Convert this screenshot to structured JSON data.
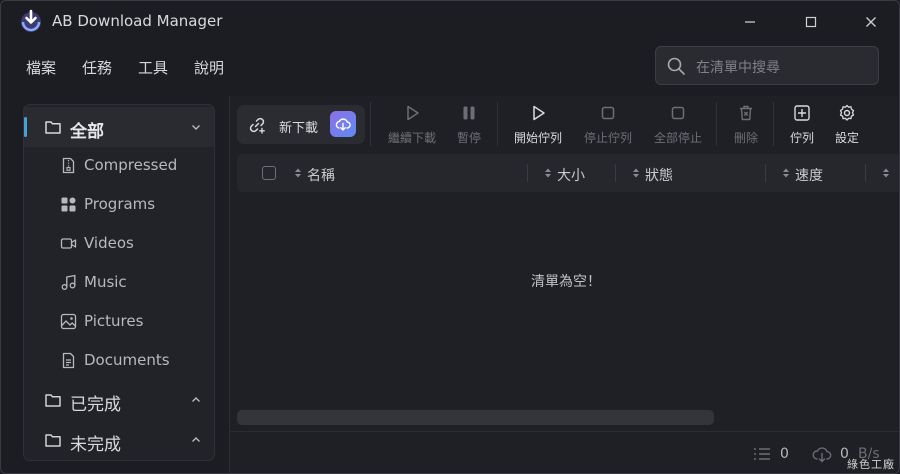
{
  "window": {
    "title": "AB Download Manager"
  },
  "menu": [
    "檔案",
    "任務",
    "工具",
    "說明"
  ],
  "search": {
    "placeholder": "在清單中搜尋"
  },
  "sidebar": {
    "all": "全部",
    "subs": [
      {
        "label": "Compressed",
        "icon": "archive-file-icon"
      },
      {
        "label": "Programs",
        "icon": "programs-grid-icon"
      },
      {
        "label": "Videos",
        "icon": "video-camera-icon"
      },
      {
        "label": "Music",
        "icon": "music-note-icon"
      },
      {
        "label": "Pictures",
        "icon": "image-icon"
      },
      {
        "label": "Documents",
        "icon": "document-icon"
      }
    ],
    "completed": "已完成",
    "unfinished": "未完成"
  },
  "toolbar": {
    "new_download": "新下載",
    "resume": "繼續下載",
    "pause": "暫停",
    "start_queue": "開始佇列",
    "stop_queue": "停止佇列",
    "stop_all": "全部停止",
    "delete": "刪除",
    "queues": "佇列",
    "settings": "設定"
  },
  "table": {
    "columns": [
      "名稱",
      "大小",
      "狀態",
      "速度"
    ],
    "empty_message": "清單為空！"
  },
  "status": {
    "active_count": "0",
    "speed_value": "0",
    "speed_unit": "B/s"
  },
  "watermark": "綠色工廠",
  "colors": {
    "accent": "#47a0d6",
    "cloud_button": "#7b7ded",
    "background": "#1c1d22"
  }
}
